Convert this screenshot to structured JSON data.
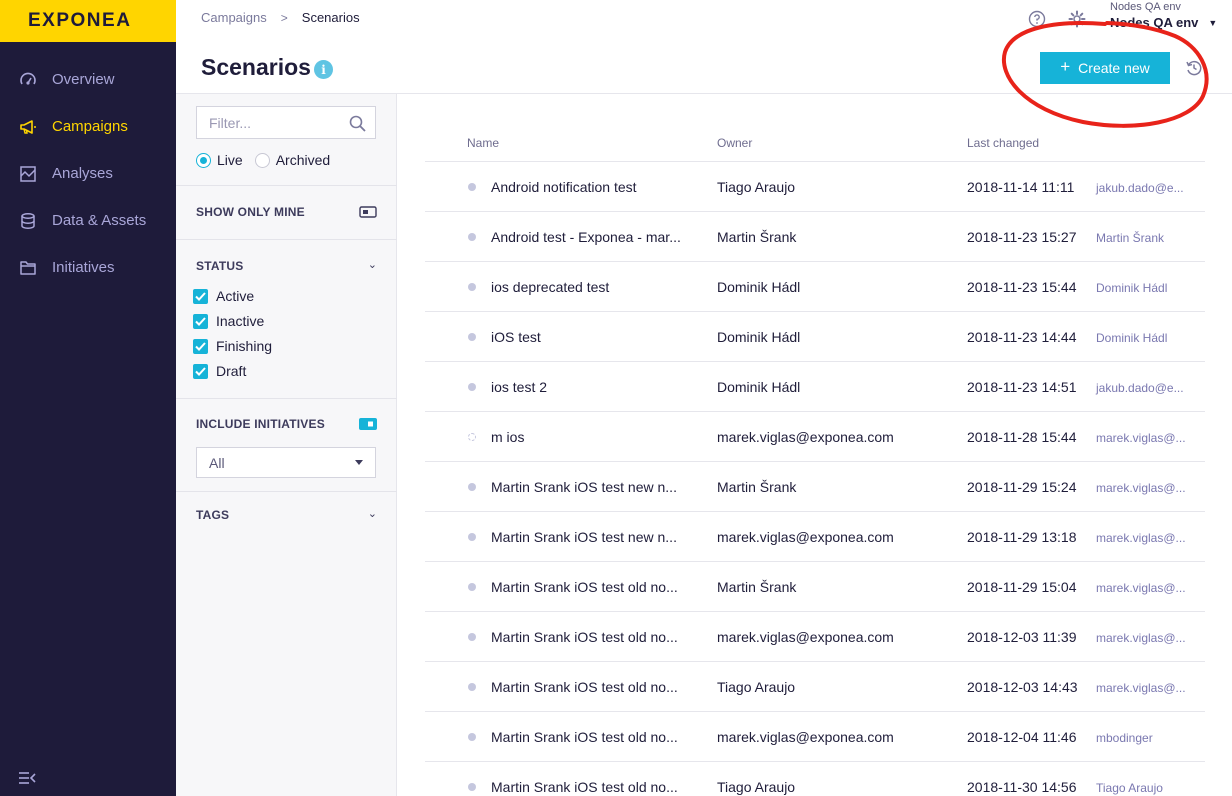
{
  "brand": {
    "logo": "EXPONEA"
  },
  "sidebar": {
    "items": [
      {
        "label": "Overview",
        "icon": "gauge-icon",
        "active": false
      },
      {
        "label": "Campaigns",
        "icon": "megaphone-icon",
        "active": true
      },
      {
        "label": "Analyses",
        "icon": "chart-icon",
        "active": false
      },
      {
        "label": "Data & Assets",
        "icon": "database-icon",
        "active": false
      },
      {
        "label": "Initiatives",
        "icon": "folder-icon",
        "active": false
      }
    ]
  },
  "breadcrumb": {
    "parent": "Campaigns",
    "separator": ">",
    "current": "Scenarios"
  },
  "env": {
    "label_small": "Nodes QA env",
    "label": "Nodes QA env"
  },
  "header": {
    "title": "Scenarios",
    "create_label": "Create new"
  },
  "filters": {
    "placeholder": "Filter...",
    "radios": [
      {
        "label": "Live",
        "checked": true
      },
      {
        "label": "Archived",
        "checked": false
      }
    ],
    "show_only_mine": "SHOW ONLY MINE",
    "status_title": "STATUS",
    "statuses": [
      "Active",
      "Inactive",
      "Finishing",
      "Draft"
    ],
    "include_initiatives": "INCLUDE INITIATIVES",
    "initiatives_select": "All",
    "tags_title": "TAGS"
  },
  "table": {
    "columns": [
      "Name",
      "Owner",
      "Last changed"
    ],
    "rows": [
      {
        "name": "Android notification test",
        "owner": "Tiago Araujo",
        "date": "2018-11-14 11:11",
        "by": "jakub.dado@e...",
        "draft": false
      },
      {
        "name": "Android test - Exponea - mar...",
        "owner": "Martin Šrank",
        "date": "2018-11-23 15:27",
        "by": "Martin Šrank",
        "draft": false
      },
      {
        "name": "ios deprecated test",
        "owner": "Dominik Hádl",
        "date": "2018-11-23 15:44",
        "by": "Dominik Hádl",
        "draft": false
      },
      {
        "name": "iOS test",
        "owner": "Dominik Hádl",
        "date": "2018-11-23 14:44",
        "by": "Dominik Hádl",
        "draft": false
      },
      {
        "name": "ios test 2",
        "owner": "Dominik Hádl",
        "date": "2018-11-23 14:51",
        "by": "jakub.dado@e...",
        "draft": false
      },
      {
        "name": "m ios",
        "owner": "marek.viglas@exponea.com",
        "date": "2018-11-28 15:44",
        "by": "marek.viglas@...",
        "draft": true
      },
      {
        "name": "Martin Srank iOS test new n...",
        "owner": "Martin Šrank",
        "date": "2018-11-29 15:24",
        "by": "marek.viglas@...",
        "draft": false
      },
      {
        "name": "Martin Srank iOS test new n...",
        "owner": "marek.viglas@exponea.com",
        "date": "2018-11-29 13:18",
        "by": "marek.viglas@...",
        "draft": false
      },
      {
        "name": "Martin Srank iOS test old no...",
        "owner": "Martin Šrank",
        "date": "2018-11-29 15:04",
        "by": "marek.viglas@...",
        "draft": false
      },
      {
        "name": "Martin Srank iOS test old no...",
        "owner": "marek.viglas@exponea.com",
        "date": "2018-12-03 11:39",
        "by": "marek.viglas@...",
        "draft": false
      },
      {
        "name": "Martin Srank iOS test old no...",
        "owner": "Tiago Araujo",
        "date": "2018-12-03 14:43",
        "by": "marek.viglas@...",
        "draft": false
      },
      {
        "name": "Martin Srank iOS test old no...",
        "owner": "marek.viglas@exponea.com",
        "date": "2018-12-04 11:46",
        "by": "mbodinger",
        "draft": false
      },
      {
        "name": "Martin Srank iOS test old no...",
        "owner": "Tiago Araujo",
        "date": "2018-11-30 14:56",
        "by": "Tiago Araujo",
        "draft": false
      }
    ]
  },
  "colors": {
    "brand_yellow": "#ffd500",
    "sidebar_bg": "#1e1b3a",
    "accent": "#16b3d8",
    "annotation": "#e8231a"
  }
}
